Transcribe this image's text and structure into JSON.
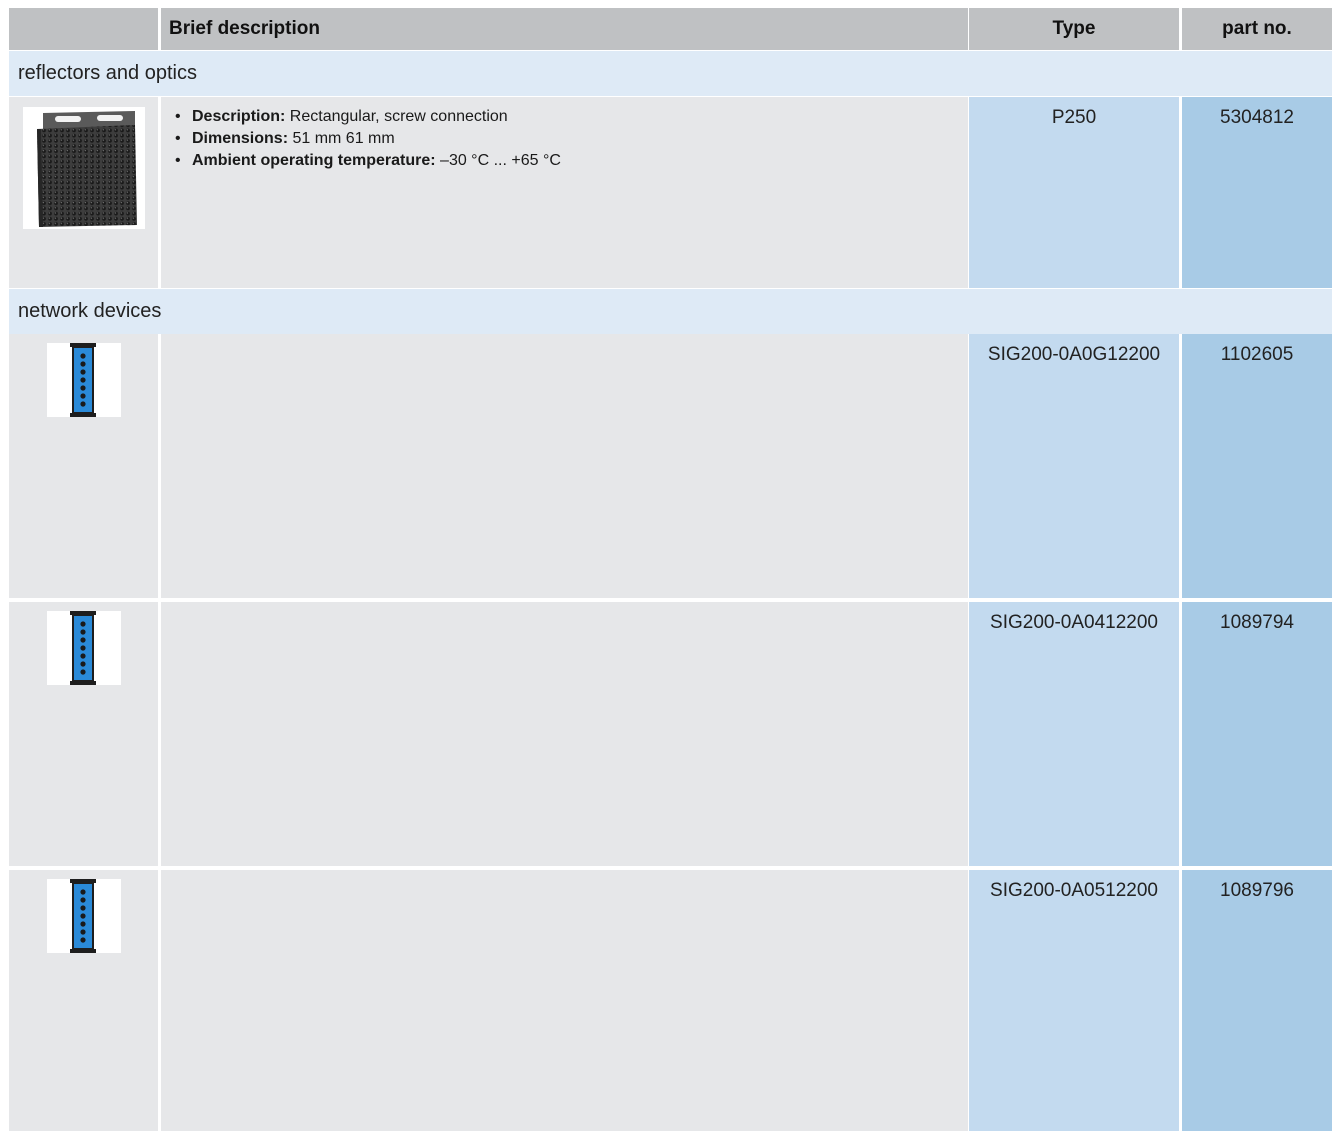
{
  "header": {
    "brief_description": "Brief description",
    "type": "Type",
    "part_no": "part no."
  },
  "sections": [
    {
      "title": "reflectors and optics"
    },
    {
      "title": "network devices"
    }
  ],
  "products": [
    {
      "image": "rectangular-reflector-image",
      "bullets": [
        {
          "label": "Description:",
          "text": " Rectangular, screw connection"
        },
        {
          "label": "Dimensions:",
          "text": " 51 mm 61 mm"
        },
        {
          "label": "Ambient operating temperature:",
          "text": " –30 °C ... +65 °C"
        }
      ],
      "type": "P250",
      "part_no": "5304812"
    },
    {
      "image": "io-link-master-image",
      "type": "SIG200-0A0G12200",
      "part_no": "1102605"
    },
    {
      "image": "io-link-master-image",
      "type": "SIG200-0A0412200",
      "part_no": "1089794"
    },
    {
      "image": "io-link-master-image",
      "type": "SIG200-0A0512200",
      "part_no": "1089796"
    }
  ],
  "colors": {
    "header_bg": "#bfc1c3",
    "section_bg": "#deeaf6",
    "cell_bg": "#e6e7e9",
    "type_bg": "#c3daef",
    "part_bg": "#a8cbe6",
    "device_blue": "#2a8ad8"
  }
}
